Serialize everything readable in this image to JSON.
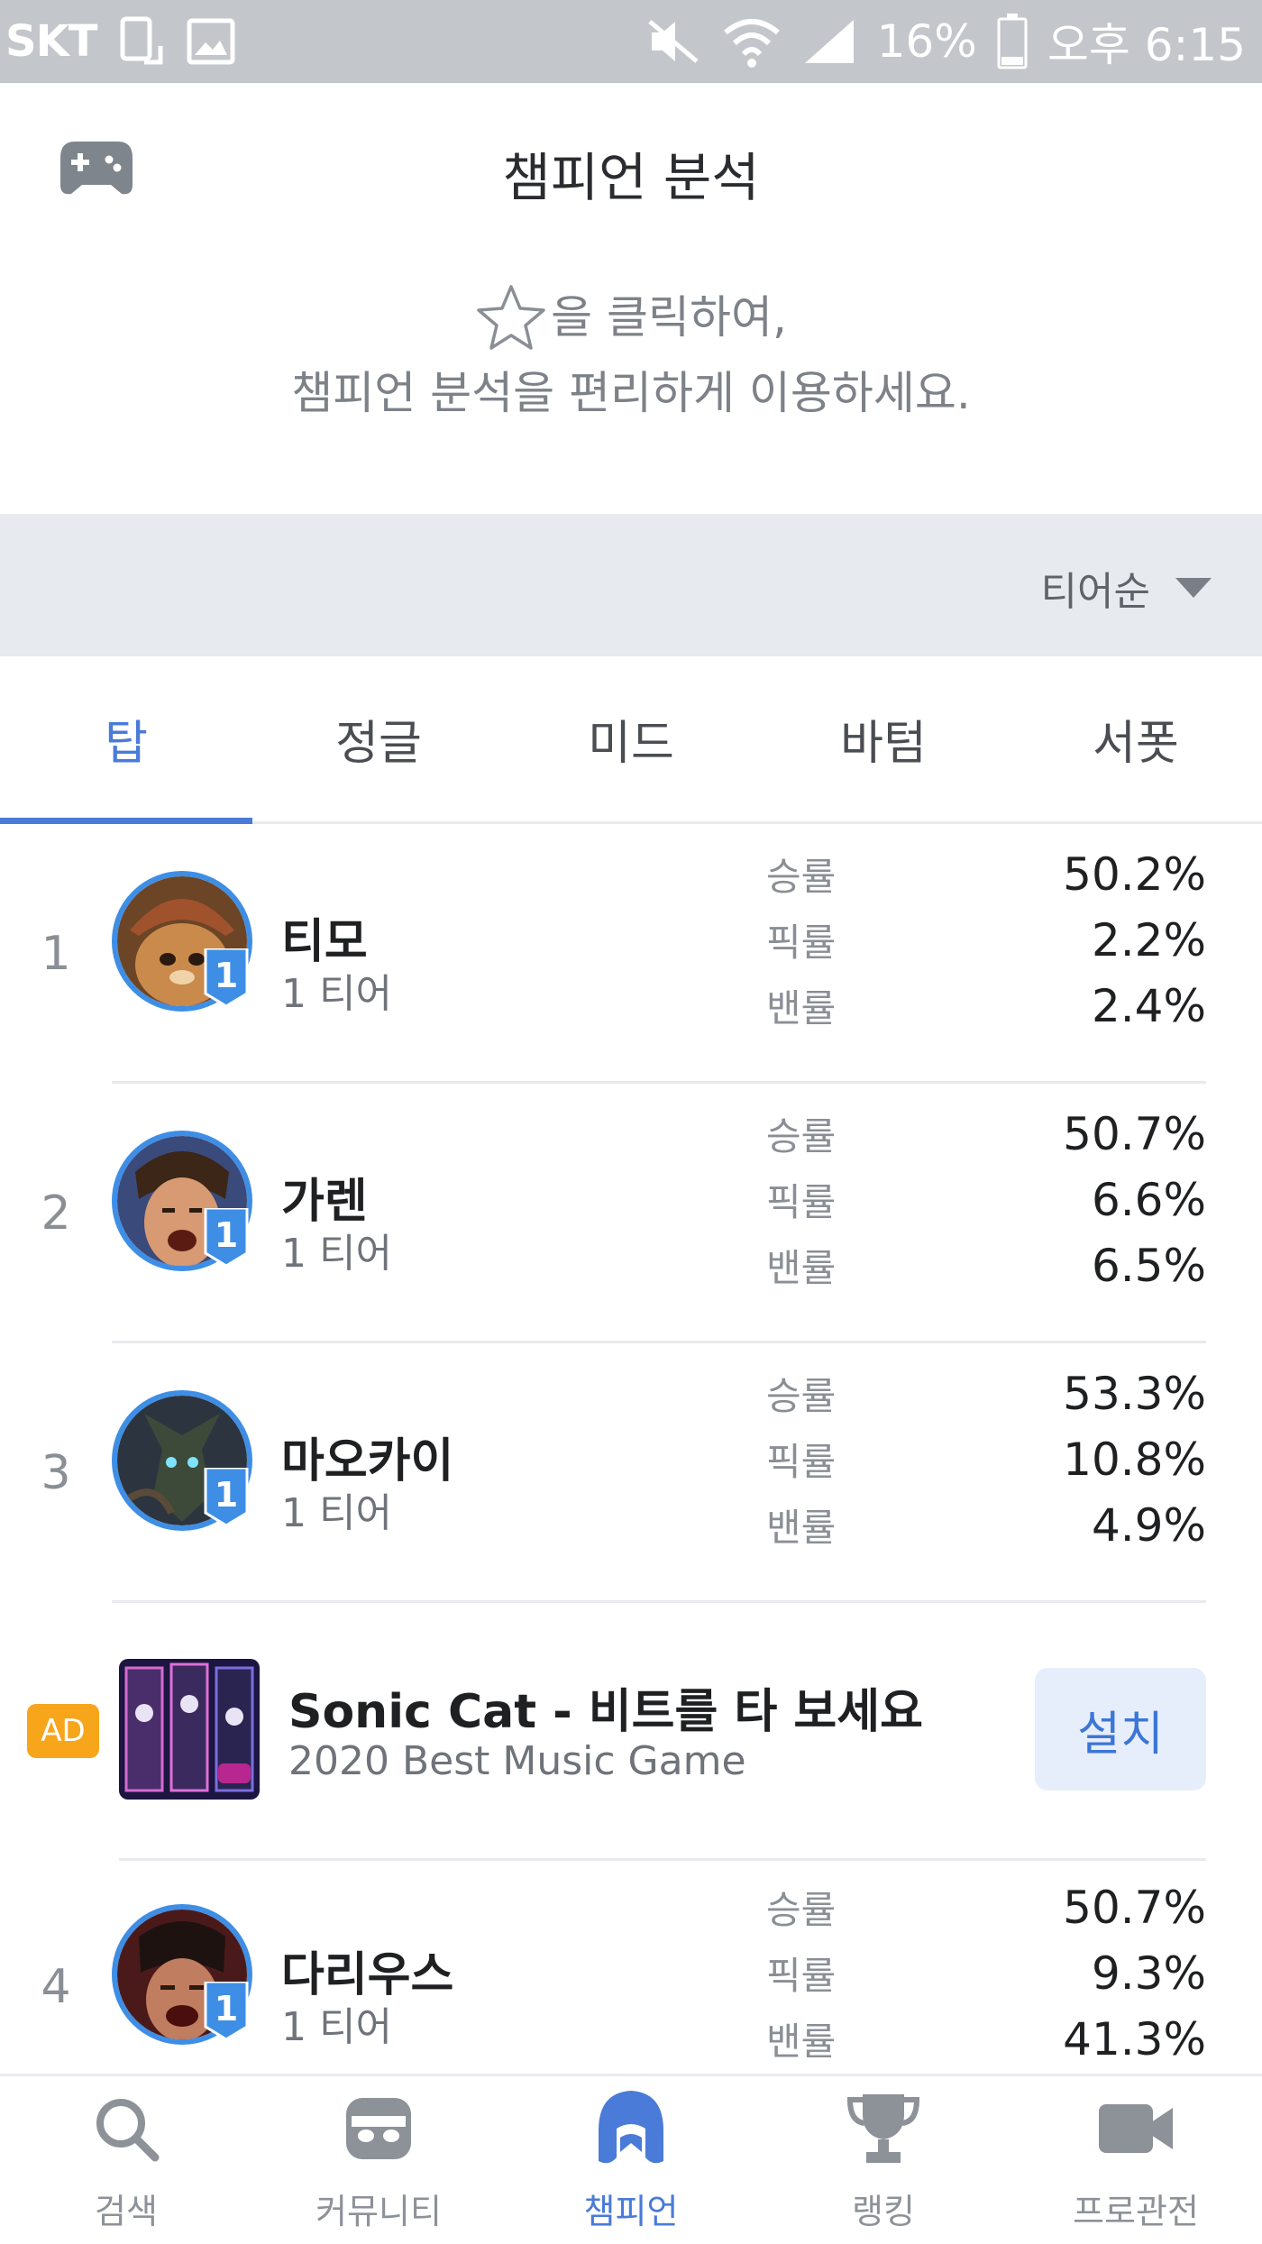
{
  "status_bar": {
    "carrier": "SKT",
    "battery": "16%",
    "time": "오후 6:15"
  },
  "header": {
    "title": "챔피언 분석"
  },
  "hint": {
    "line1": "을 클릭하여,",
    "line2": "챔피언 분석을 편리하게 이용하세요."
  },
  "sort": {
    "label": "티어순"
  },
  "tabs": [
    {
      "label": "탑",
      "active": true
    },
    {
      "label": "정글",
      "active": false
    },
    {
      "label": "미드",
      "active": false
    },
    {
      "label": "바텀",
      "active": false
    },
    {
      "label": "서폿",
      "active": false
    }
  ],
  "stat_labels": {
    "win": "승률",
    "pick": "픽률",
    "ban": "밴률"
  },
  "champions": [
    {
      "rank": "1",
      "name": "티모",
      "tier": "1 티어",
      "tier_badge": "1",
      "win": "50.2%",
      "pick": "2.2%",
      "ban": "2.4%"
    },
    {
      "rank": "2",
      "name": "가렌",
      "tier": "1 티어",
      "tier_badge": "1",
      "win": "50.7%",
      "pick": "6.6%",
      "ban": "6.5%"
    },
    {
      "rank": "3",
      "name": "마오카이",
      "tier": "1 티어",
      "tier_badge": "1",
      "win": "53.3%",
      "pick": "10.8%",
      "ban": "4.9%"
    },
    {
      "rank": "4",
      "name": "다리우스",
      "tier": "1 티어",
      "tier_badge": "1",
      "win": "50.7%",
      "pick": "9.3%",
      "ban": "41.3%"
    }
  ],
  "ad": {
    "badge": "AD",
    "title": "Sonic Cat - 비트를 타 보세요",
    "subtitle": "2020 Best Music Game",
    "install_label": "설치"
  },
  "bottom_nav": [
    {
      "label": "검색",
      "icon": "search-icon",
      "active": false
    },
    {
      "label": "커뮤니티",
      "icon": "community-icon",
      "active": false
    },
    {
      "label": "챔피언",
      "icon": "champion-helmet-icon",
      "active": true
    },
    {
      "label": "랭킹",
      "icon": "trophy-icon",
      "active": false
    },
    {
      "label": "프로관전",
      "icon": "video-camera-icon",
      "active": false
    }
  ],
  "colors": {
    "accent": "#4a7bd8",
    "status_bar": "#c3c6cb",
    "ad_badge": "#f7a51b"
  }
}
